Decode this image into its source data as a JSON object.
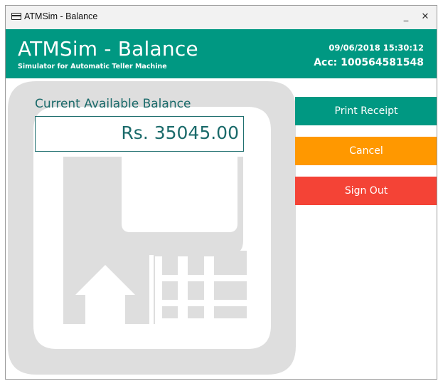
{
  "window": {
    "title": "ATMSim - Balance",
    "minimize": "_",
    "close": "✕"
  },
  "header": {
    "title": "ATMSim - Balance",
    "subtitle": "Simulator for Automatic Teller Machine",
    "datetime": "09/06/2018 15:30:12",
    "account": "Acc: 100564581548"
  },
  "balance": {
    "label": "Current Available Balance",
    "value": "Rs. 35045.00"
  },
  "actions": {
    "print": "Print Receipt",
    "cancel": "Cancel",
    "signout": "Sign Out"
  },
  "colors": {
    "primary": "#009882",
    "cancel": "#ff9800",
    "signout": "#f44336",
    "watermark": "#dedede"
  }
}
